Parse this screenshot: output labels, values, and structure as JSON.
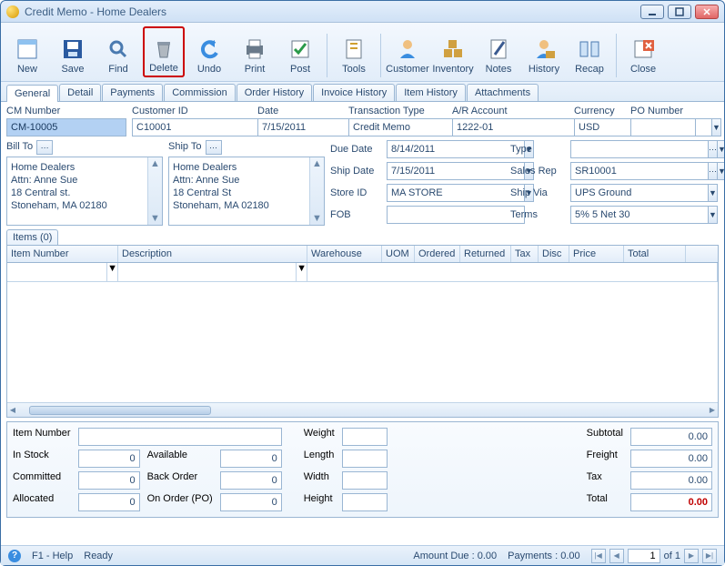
{
  "window": {
    "title": "Credit Memo - Home Dealers"
  },
  "toolbar": [
    {
      "name": "new",
      "label": "New"
    },
    {
      "name": "save",
      "label": "Save"
    },
    {
      "name": "find",
      "label": "Find"
    },
    {
      "name": "delete",
      "label": "Delete",
      "highlight": true
    },
    {
      "name": "undo",
      "label": "Undo"
    },
    {
      "name": "print",
      "label": "Print"
    },
    {
      "name": "post",
      "label": "Post"
    },
    {
      "name": "tools",
      "label": "Tools"
    },
    {
      "name": "customer",
      "label": "Customer"
    },
    {
      "name": "inventory",
      "label": "Inventory"
    },
    {
      "name": "notes",
      "label": "Notes"
    },
    {
      "name": "history",
      "label": "History"
    },
    {
      "name": "recap",
      "label": "Recap"
    },
    {
      "name": "close",
      "label": "Close"
    }
  ],
  "tabs": [
    "General",
    "Detail",
    "Payments",
    "Commission",
    "Order History",
    "Invoice History",
    "Item History",
    "Attachments"
  ],
  "active_tab": "General",
  "fields": {
    "cm_number": {
      "label": "CM Number",
      "value": "CM-10005"
    },
    "customer_id": {
      "label": "Customer ID",
      "value": "C10001"
    },
    "date": {
      "label": "Date",
      "value": "7/15/2011"
    },
    "txn_type": {
      "label": "Transaction Type",
      "value": "Credit Memo"
    },
    "ar_account": {
      "label": "A/R Account",
      "value": "1222-01"
    },
    "currency": {
      "label": "Currency",
      "value": "USD"
    },
    "po_number": {
      "label": "PO Number",
      "value": ""
    },
    "bill_to": {
      "label": "Bill To",
      "lines": [
        "Home Dealers",
        "Attn: Anne Sue",
        "18 Central st.",
        "Stoneham, MA 02180"
      ]
    },
    "ship_to": {
      "label": "Ship To",
      "lines": [
        "Home Dealers",
        "Attn: Anne Sue",
        "18 Central St",
        "Stoneham, MA 02180"
      ]
    },
    "due_date": {
      "label": "Due Date",
      "value": "8/14/2011"
    },
    "ship_date": {
      "label": "Ship Date",
      "value": "7/15/2011"
    },
    "store_id": {
      "label": "Store ID",
      "value": "MA STORE"
    },
    "fob": {
      "label": "FOB",
      "value": ""
    },
    "type": {
      "label": "Type",
      "value": ""
    },
    "sales_rep": {
      "label": "Sales Rep",
      "value": "SR10001"
    },
    "ship_via": {
      "label": "Ship Via",
      "value": "UPS Ground"
    },
    "terms": {
      "label": "Terms",
      "value": "5% 5 Net 30"
    }
  },
  "items_header": "Items (0)",
  "grid_cols": [
    "Item Number",
    "Description",
    "Warehouse",
    "UOM",
    "Ordered",
    "Returned",
    "Tax",
    "Disc",
    "Price",
    "Total"
  ],
  "footer": {
    "item_number": {
      "label": "Item Number",
      "value": ""
    },
    "in_stock": {
      "label": "In Stock",
      "value": "0"
    },
    "committed": {
      "label": "Committed",
      "value": "0"
    },
    "allocated": {
      "label": "Allocated",
      "value": "0"
    },
    "available": {
      "label": "Available",
      "value": "0"
    },
    "back_order": {
      "label": "Back Order",
      "value": "0"
    },
    "on_order": {
      "label": "On Order (PO)",
      "value": "0"
    },
    "weight": {
      "label": "Weight",
      "value": ""
    },
    "length": {
      "label": "Length",
      "value": ""
    },
    "width": {
      "label": "Width",
      "value": ""
    },
    "height": {
      "label": "Height",
      "value": ""
    },
    "subtotal": {
      "label": "Subtotal",
      "value": "0.00"
    },
    "freight": {
      "label": "Freight",
      "value": "0.00"
    },
    "tax": {
      "label": "Tax",
      "value": "0.00"
    },
    "total": {
      "label": "Total",
      "value": "0.00"
    }
  },
  "status": {
    "help": "F1 - Help",
    "ready": "Ready",
    "amount_due": "Amount Due : 0.00",
    "payments": "Payments : 0.00",
    "page": "1",
    "of": "of  1"
  }
}
